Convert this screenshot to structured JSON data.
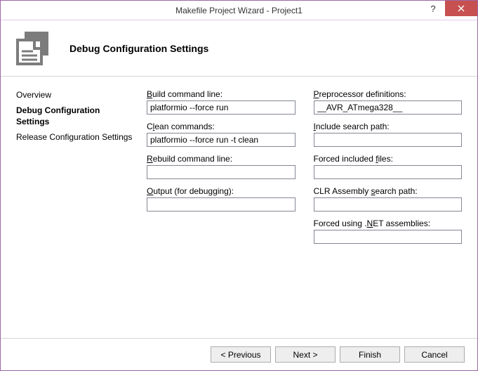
{
  "window": {
    "title": "Makefile Project Wizard - Project1"
  },
  "header": {
    "title": "Debug Configuration Settings"
  },
  "nav": {
    "items": [
      {
        "label": "Overview",
        "selected": false
      },
      {
        "label": "Debug Configuration Settings",
        "selected": true
      },
      {
        "label": "Release Configuration Settings",
        "selected": false
      }
    ]
  },
  "form": {
    "left": [
      {
        "label_pre": "",
        "label_ul": "B",
        "label_post": "uild command line:",
        "value": "platformio --force run"
      },
      {
        "label_pre": "C",
        "label_ul": "l",
        "label_post": "ean commands:",
        "value": "platformio --force run -t clean"
      },
      {
        "label_pre": "",
        "label_ul": "R",
        "label_post": "ebuild command line:",
        "value": ""
      },
      {
        "label_pre": "",
        "label_ul": "O",
        "label_post": "utput (for debugging):",
        "value": ""
      }
    ],
    "right": [
      {
        "label_pre": "",
        "label_ul": "P",
        "label_post": "reprocessor definitions:",
        "value": "__AVR_ATmega328__"
      },
      {
        "label_pre": "",
        "label_ul": "I",
        "label_post": "nclude search path:",
        "value": ""
      },
      {
        "label_pre": "Forced included ",
        "label_ul": "f",
        "label_post": "iles:",
        "value": ""
      },
      {
        "label_pre": "CLR Assembly ",
        "label_ul": "s",
        "label_post": "earch path:",
        "value": ""
      },
      {
        "label_pre": "Forced using .",
        "label_ul": "N",
        "label_post": "ET assemblies:",
        "value": ""
      }
    ]
  },
  "footer": {
    "previous": "< Previous",
    "next": "Next >",
    "finish": "Finish",
    "cancel": "Cancel"
  },
  "icons": {
    "help": "?",
    "close": "✕"
  }
}
